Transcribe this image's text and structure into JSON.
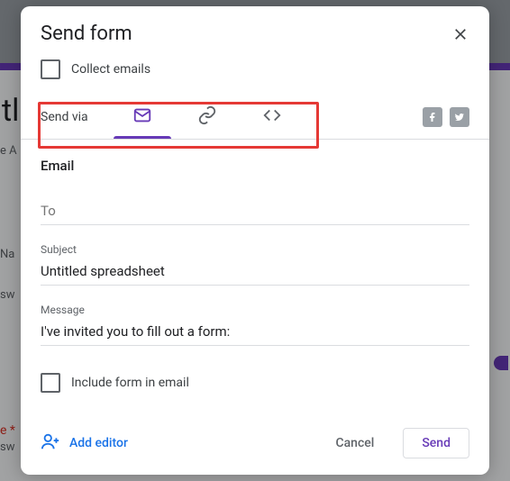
{
  "modal": {
    "title": "Send form",
    "collect_label": "Collect emails",
    "send_via_label": "Send via",
    "include_label": "Include form in email",
    "add_editor_label": "Add editor",
    "cancel_label": "Cancel",
    "send_label": "Send"
  },
  "email": {
    "section_title": "Email",
    "to_label": "To",
    "to_value": "",
    "subject_label": "Subject",
    "subject_value": "Untitled spreadsheet",
    "message_label": "Message",
    "message_value": "I've invited you to fill out a form:"
  },
  "bg": {
    "title_fragment": "tl",
    "na": "Na",
    "sw": "sw",
    "e": "e",
    "ast": "*",
    "a": "e A"
  }
}
